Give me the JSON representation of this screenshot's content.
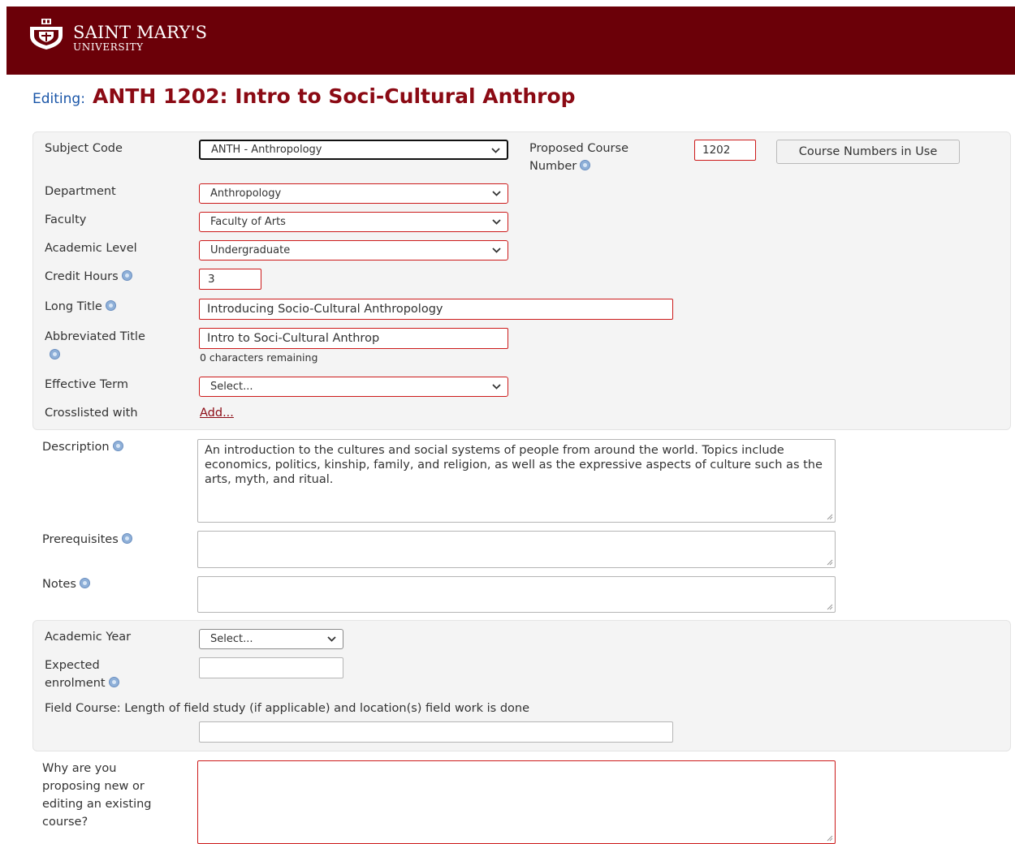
{
  "header": {
    "logo_name": "SAINT MARY'S",
    "logo_sub": "UNIVERSITY"
  },
  "page": {
    "title_prefix": "Editing:",
    "title_course": "ANTH 1202: Intro to Soci-Cultural Anthrop"
  },
  "form": {
    "subject_code": {
      "label": "Subject Code",
      "value": "ANTH - Anthropology"
    },
    "proposed_course_number": {
      "label_line1": "Proposed Course",
      "label_line2": "Number",
      "value": "1202"
    },
    "course_numbers_button": "Course Numbers in Use",
    "department": {
      "label": "Department",
      "value": "Anthropology"
    },
    "faculty": {
      "label": "Faculty",
      "value": "Faculty of Arts"
    },
    "academic_level": {
      "label": "Academic Level",
      "value": "Undergraduate"
    },
    "credit_hours": {
      "label": "Credit Hours",
      "value": "3"
    },
    "long_title": {
      "label": "Long Title",
      "value": "Introducing Socio-Cultural Anthropology"
    },
    "abbreviated_title": {
      "label": "Abbreviated Title",
      "value": "Intro to Soci-Cultural Anthrop",
      "remaining": "0 characters remaining"
    },
    "effective_term": {
      "label": "Effective Term",
      "value": "Select..."
    },
    "crosslisted": {
      "label": "Crosslisted with",
      "link": "Add..."
    },
    "description": {
      "label": "Description",
      "value": "An introduction to the cultures and social systems of people from around the world. Topics include economics, politics, kinship, family, and religion, as well as the expressive aspects of culture such as the arts, myth, and ritual."
    },
    "prerequisites": {
      "label": "Prerequisites",
      "value": ""
    },
    "notes": {
      "label": "Notes",
      "value": ""
    },
    "academic_year": {
      "label": "Academic Year",
      "value": "Select..."
    },
    "expected_enrolment": {
      "label_line1": "Expected",
      "label_line2": "enrolment",
      "value": ""
    },
    "field_course": {
      "label": "Field Course: Length of field study (if applicable) and location(s) field work is done",
      "value": ""
    },
    "why_proposing": {
      "label_lines": [
        "Why are you",
        "proposing new or",
        "editing an existing",
        "course?"
      ],
      "value": ""
    }
  },
  "icons": {
    "help": "help-icon",
    "dropdown": "chevron-down-icon",
    "resize": "resize-grip-icon",
    "logo": "university-crest-icon"
  },
  "colors": {
    "header_bg": "#6b0008",
    "title_course": "#8b0a14",
    "title_prefix": "#1a56a8",
    "required_border": "#cc1a1a",
    "panel_bg": "#f4f4f4"
  }
}
